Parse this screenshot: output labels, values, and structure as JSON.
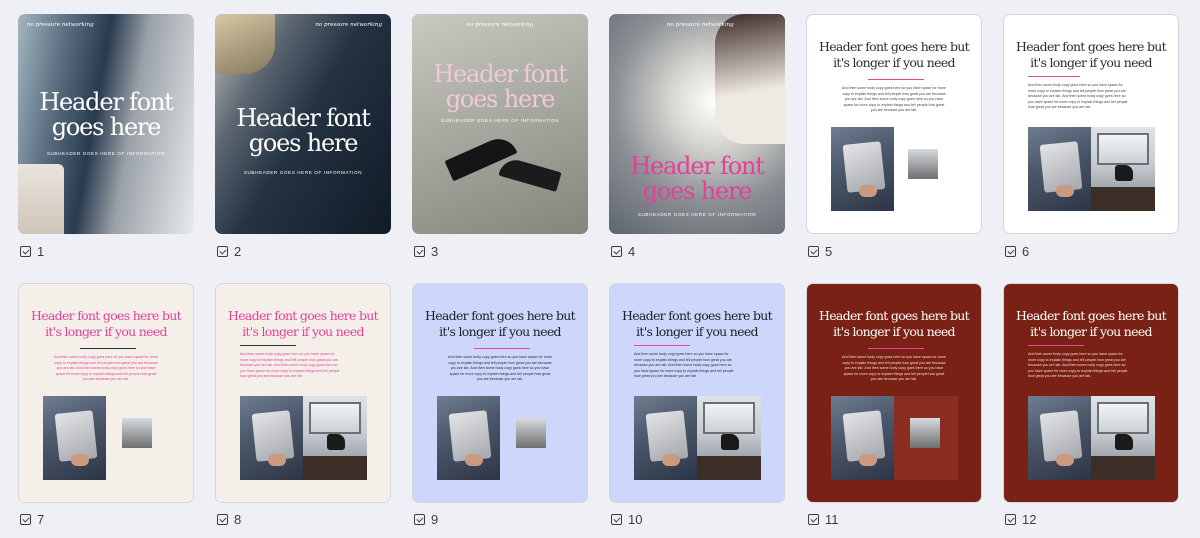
{
  "pages": [
    {
      "number": "1",
      "type": "photo",
      "brand": "no pressure networking",
      "header_line1": "Header font",
      "header_line2": "goes here",
      "subheader": "SUBHEADER GOES HERE OF INFORMATION",
      "header_color": "#ffffff"
    },
    {
      "number": "2",
      "type": "photo",
      "brand": "no pressure networking",
      "header_line1": "Header font",
      "header_line2": "goes here",
      "subheader": "SUBHEADER GOES HERE OF INFORMATION",
      "header_color": "#ffffff"
    },
    {
      "number": "3",
      "type": "photo",
      "brand": "no pressure networking",
      "header_line1": "Header font",
      "header_line2": "goes here",
      "subheader": "SUBHEADER GOES HERE OF INFORMATION",
      "header_color": "#f1c7da"
    },
    {
      "number": "4",
      "type": "photo",
      "brand": "no pressure networking",
      "header_line1": "Header font",
      "header_line2": "goes here",
      "subheader": "SUBHEADER GOES HERE OF INFORMATION",
      "header_color": "#e4409a"
    },
    {
      "number": "5",
      "type": "text",
      "background": "#ffffff",
      "header_line1": "Header font goes here but",
      "header_line2": "it's longer if you need",
      "header_color": "#2b2b2b",
      "body_color": "#444444",
      "rule_color": "#e8479b",
      "body": "And then some body copy goes here so you have space for more copy to explain things and tell people how great you are because you are lab. And then some body copy goes here so you have space for more copy to explain things and tell people how great you are because you are lab."
    },
    {
      "number": "6",
      "type": "text",
      "background": "#ffffff",
      "header_line1": "Header font goes here but",
      "header_line2": "it's longer if you need",
      "header_color": "#2b2b2b",
      "body_color": "#444444",
      "rule_color": "#e8479b",
      "body": "And then some body copy goes here so you have space for more copy to explain things and tell people how great you are because you are lab. And then some body copy goes here so you have space for more copy to explain things and tell people how great you are because you are lab."
    },
    {
      "number": "7",
      "type": "text",
      "background": "#f4efe8",
      "header_line1": "Header font goes here but",
      "header_line2": "it's longer if you need",
      "header_color": "#e0449a",
      "body_color": "#e0449a",
      "rule_color": "#333333",
      "body": "And then some body copy goes here so you have space for more copy to explain things and tell people how great you are because you are lab. And then some body copy goes here so you have space for more copy to explain things and tell people how great you are because you are lab."
    },
    {
      "number": "8",
      "type": "text",
      "background": "#f4efe8",
      "header_line1": "Header font goes here but",
      "header_line2": "it's longer if you need",
      "header_color": "#e0449a",
      "body_color": "#e0449a",
      "rule_color": "#333333",
      "body": "And then some body copy goes here so you have space for more copy to explain things and tell people how great you are because you are lab. And then some body copy goes here so you have space for more copy to explain things and tell people how great you are because you are lab."
    },
    {
      "number": "9",
      "type": "text",
      "background": "#cdd7fb",
      "header_line1": "Header font goes here but",
      "header_line2": "it's longer if you need",
      "header_color": "#1f1f2a",
      "body_color": "#2a2a36",
      "rule_color": "#e8479b",
      "body": "And then some body copy goes here so you have space for more copy to explain things and tell people how great you are because you are lab. And then some body copy goes here so you have space for more copy to explain things and tell people how great you are because you are lab."
    },
    {
      "number": "10",
      "type": "text",
      "background": "#cdd7fb",
      "header_line1": "Header font goes here but",
      "header_line2": "it's longer if you need",
      "header_color": "#1f1f2a",
      "body_color": "#2a2a36",
      "rule_color": "#e8479b",
      "body": "And then some body copy goes here so you have space for more copy to explain things and tell people how great you are because you are lab. And then some body copy goes here so you have space for more copy to explain things and tell people how great you are because you are lab."
    },
    {
      "number": "11",
      "type": "text",
      "background": "#7a2115",
      "header_line1": "Header font goes here but",
      "header_line2": "it's longer if you need",
      "header_color": "#ffffff",
      "body_color": "#f4d9d4",
      "rule_color": "#e8479b",
      "body": "And then some body copy goes here so you have space for more copy to explain things and tell people how great you are because you are lab. And then some body copy goes here so you have space for more copy to explain things and tell people how great you are because you are lab."
    },
    {
      "number": "12",
      "type": "text",
      "background": "#7a2115",
      "header_line1": "Header font goes here but",
      "header_line2": "it's longer if you need",
      "header_color": "#ffffff",
      "body_color": "#f4d9d4",
      "rule_color": "#e8479b",
      "body": "And then some body copy goes here so you have space for more copy to explain things and tell people how great you are because you are lab. And then some body copy goes here so you have space for more copy to explain things and tell people how great you are because you are lab."
    }
  ]
}
